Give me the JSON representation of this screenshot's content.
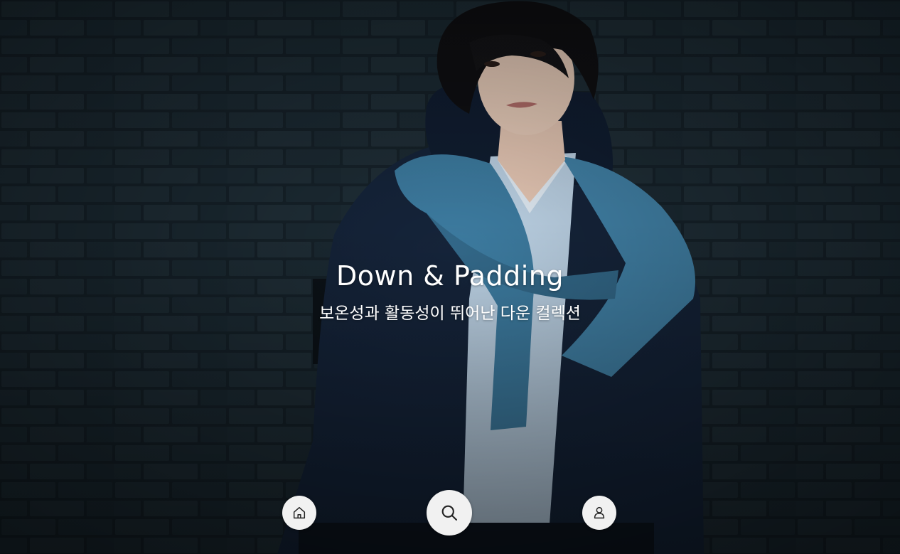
{
  "hero": {
    "title": "Down & Padding",
    "subtitle": "보온성과 활동성이 뛰어난 다운 컬렉션",
    "image_description_icon": "photo"
  },
  "bottom_nav": {
    "items": [
      {
        "id": "home",
        "icon": "home-icon"
      },
      {
        "id": "search",
        "icon": "search-icon"
      },
      {
        "id": "account",
        "icon": "user-icon"
      }
    ]
  },
  "colors": {
    "background": "#141f28",
    "brick": "#1c2a33",
    "jacket": "#16263f",
    "scarf": "#3f7ea3",
    "shirt": "#bcd3e8",
    "text": "#ffffff",
    "nav_button": "#f1f1f1"
  }
}
